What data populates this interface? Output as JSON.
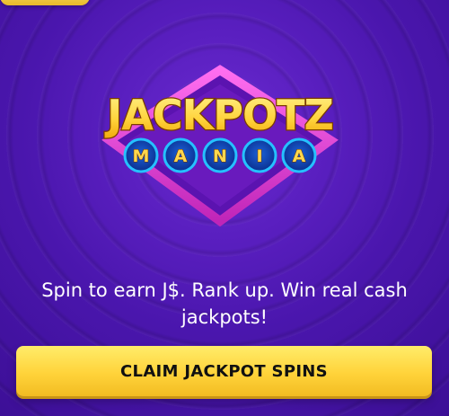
{
  "logo": {
    "line1": "JACKPOTZ",
    "line2": [
      "M",
      "A",
      "N",
      "I",
      "A"
    ]
  },
  "tagline": "Spin to earn J$. Rank up. Win real cash jackpots!",
  "cta": {
    "label": "CLAIM JACKPOT SPINS"
  },
  "colors": {
    "background": "#4a16ad",
    "logo_frame": "#e14bd7",
    "logo_text": "#ffd54a",
    "chip_ring": "#22b6ff",
    "cta": "#ffd33a"
  },
  "icons": {
    "logo": "jackpotz-mania-logo"
  }
}
